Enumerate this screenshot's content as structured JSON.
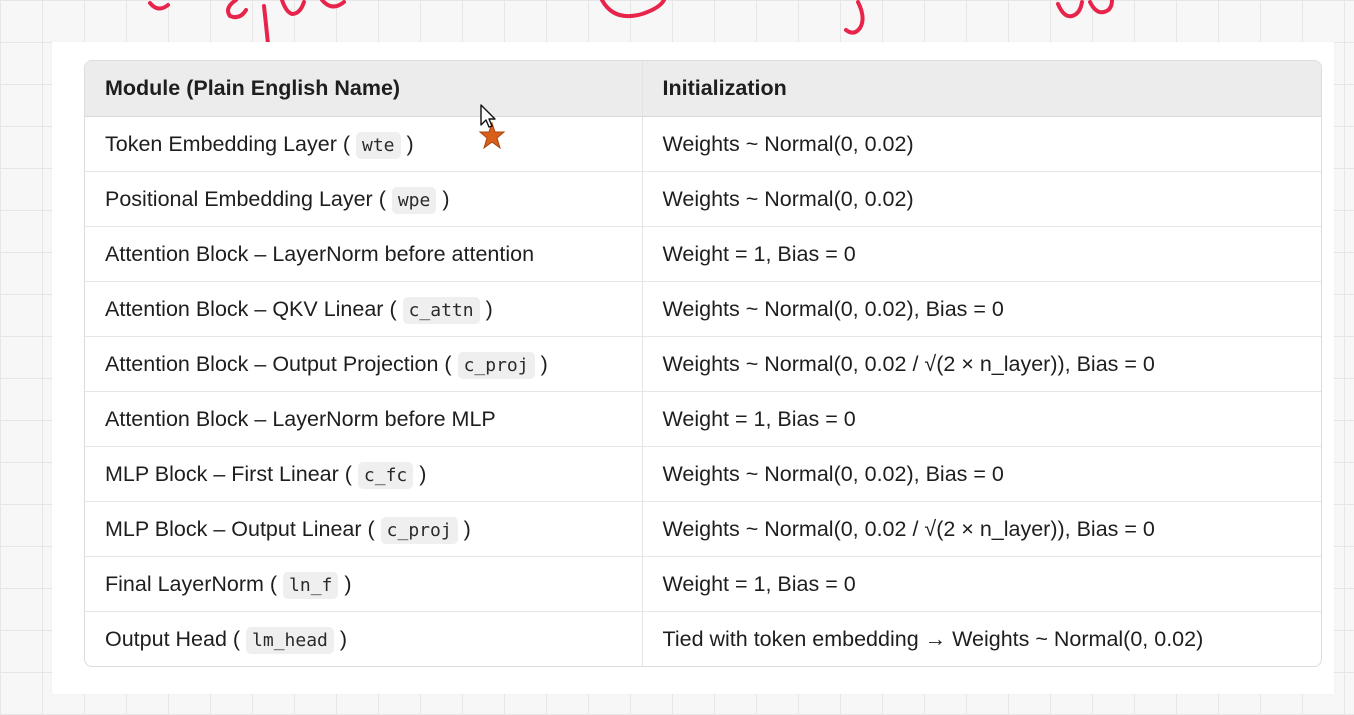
{
  "table": {
    "headers": [
      "Module (Plain English Name)",
      "Initialization"
    ],
    "rows": [
      {
        "module": "Token Embedding Layer",
        "code": "wte",
        "init": "Weights ~ Normal(0, 0.02)"
      },
      {
        "module": "Positional Embedding Layer",
        "code": "wpe",
        "init": "Weights ~ Normal(0, 0.02)"
      },
      {
        "module": "Attention Block – LayerNorm before attention",
        "code": "",
        "init": "Weight = 1, Bias = 0"
      },
      {
        "module": "Attention Block – QKV Linear",
        "code": "c_attn",
        "init": "Weights ~ Normal(0, 0.02), Bias = 0"
      },
      {
        "module": "Attention Block – Output Projection",
        "code": "c_proj",
        "init": "Weights ~ Normal(0, 0.02 / √(2 × n_layer)), Bias = 0"
      },
      {
        "module": "Attention Block – LayerNorm before MLP",
        "code": "",
        "init": "Weight = 1, Bias = 0"
      },
      {
        "module": "MLP Block – First Linear",
        "code": "c_fc",
        "init": "Weights ~ Normal(0, 0.02), Bias = 0"
      },
      {
        "module": "MLP Block – Output Linear",
        "code": "c_proj",
        "init": "Weights ~ Normal(0, 0.02 / √(2 × n_layer)), Bias = 0"
      },
      {
        "module": "Final LayerNorm",
        "code": "ln_f",
        "init": "Weight = 1, Bias = 0"
      },
      {
        "module": "Output Head",
        "code": "lm_head",
        "init": "Tied with token embedding → Weights ~ Normal(0, 0.02)"
      }
    ]
  },
  "colors": {
    "annotation_ink": "#e8244a",
    "cursor_highlight": "#d9601a"
  }
}
